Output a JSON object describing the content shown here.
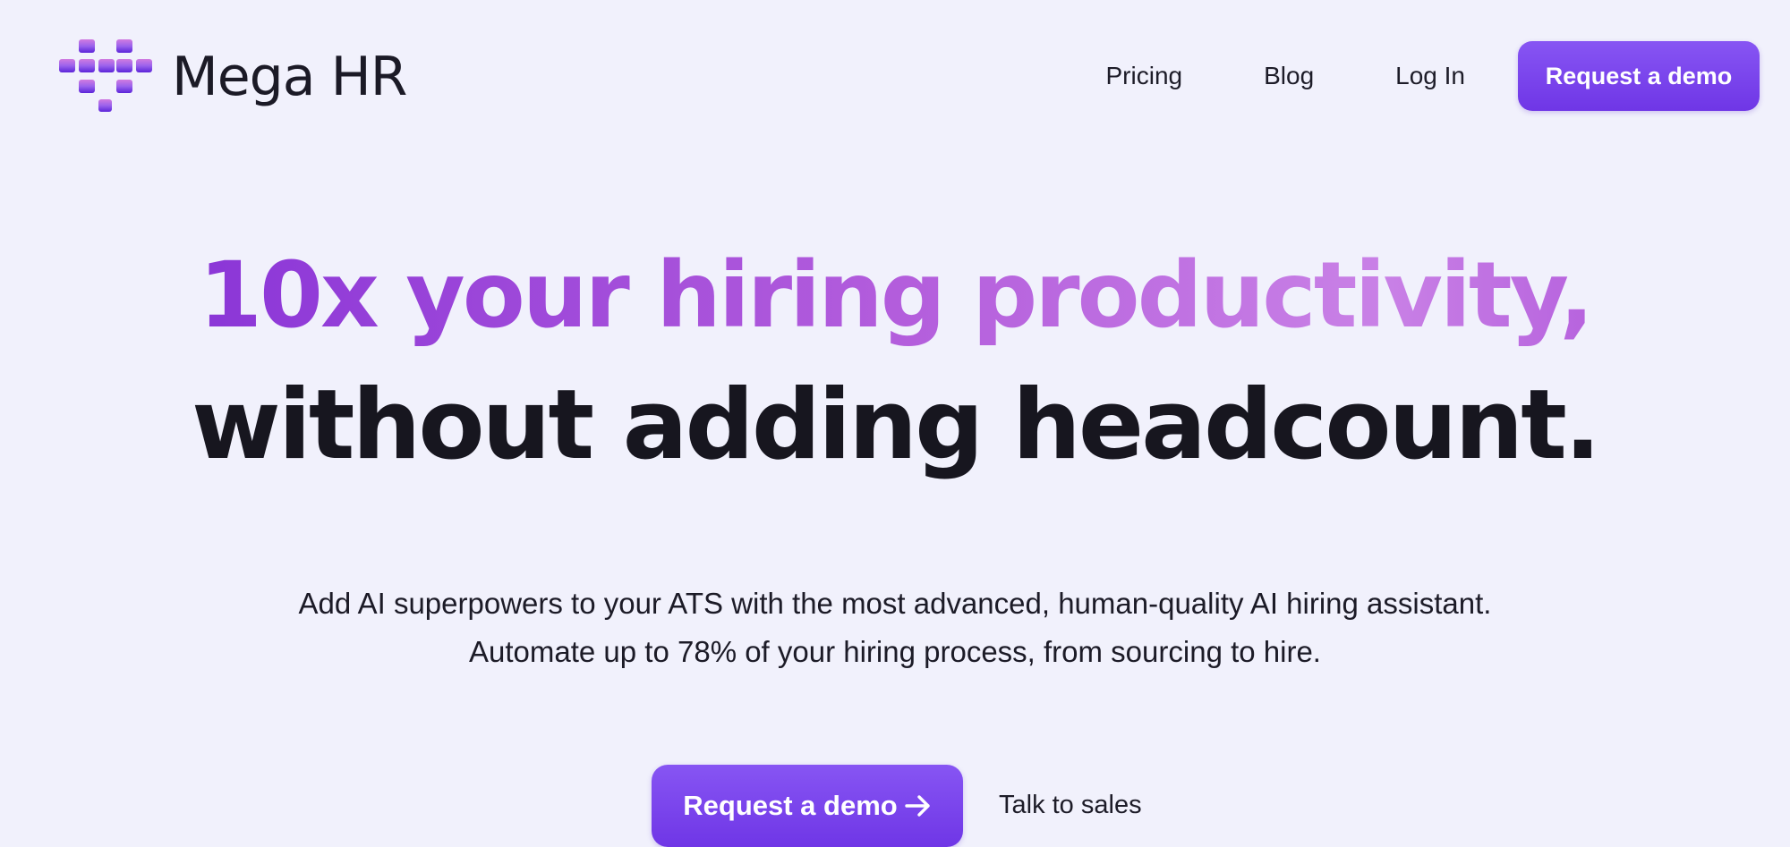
{
  "brand": {
    "name": "Mega HR",
    "logo_icon": "mega-hr-logo-icon",
    "colors": {
      "accent": "#7c46ee",
      "accent_dark": "#6a34e2",
      "gradient_start": "#8b36d7",
      "gradient_end": "#c981e6",
      "background": "#f1f1fc",
      "text": "#17161f"
    }
  },
  "nav": {
    "pricing": "Pricing",
    "blog": "Blog",
    "login": "Log In",
    "cta": "Request a demo"
  },
  "hero": {
    "headline_highlight": "10x your hiring productivity,",
    "headline_rest": "without adding headcount.",
    "subtitle_line1": "Add AI superpowers to your ATS with the most advanced, human-quality AI hiring assistant.",
    "subtitle_line2": "Automate up to 78% of your hiring process, from sourcing to hire."
  },
  "cta": {
    "primary_label": "Request a demo",
    "primary_icon": "arrow-right-icon",
    "secondary_label": "Talk to sales"
  }
}
